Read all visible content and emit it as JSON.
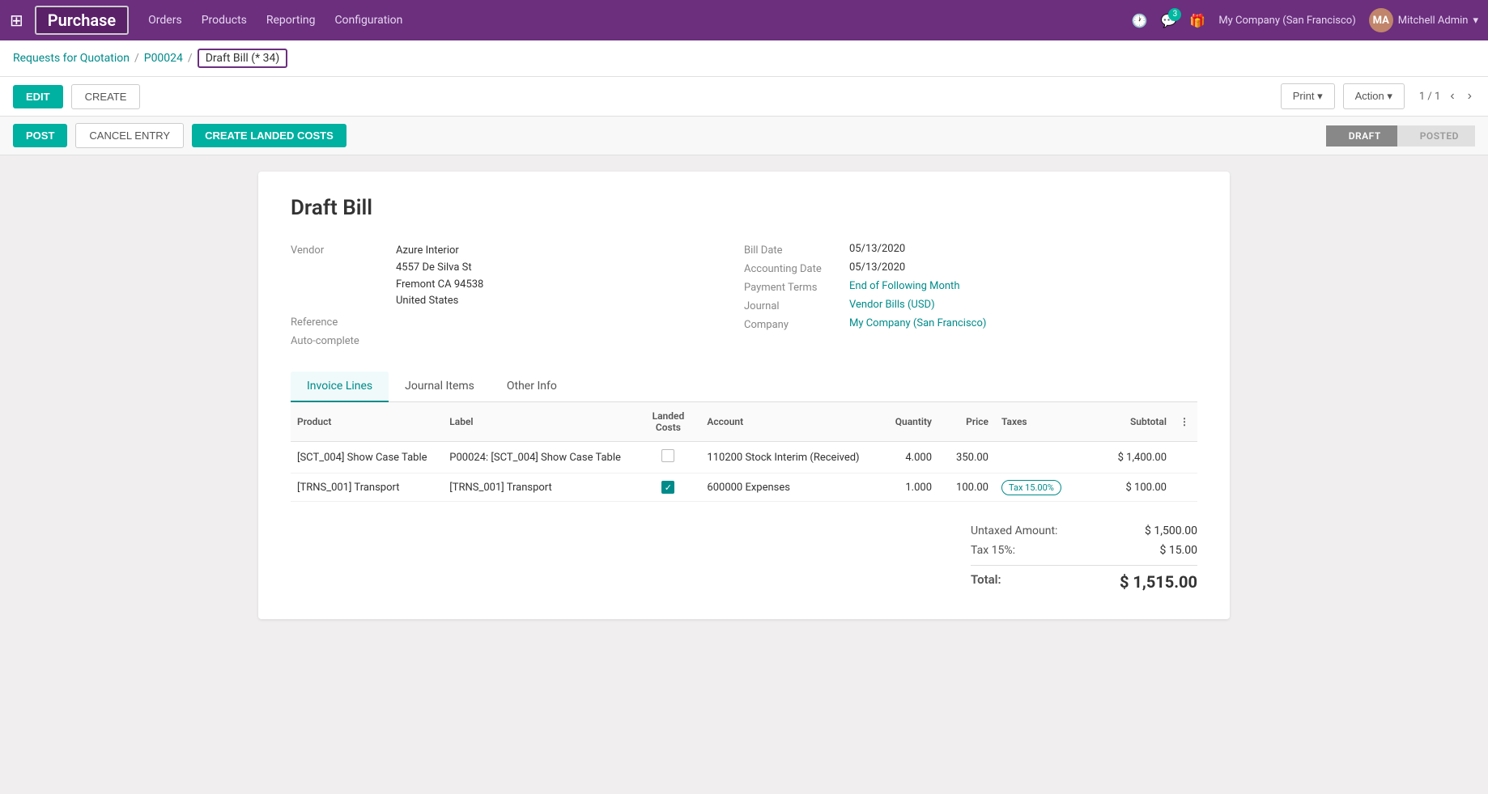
{
  "topnav": {
    "app_title": "Purchase",
    "menu_items": [
      "Orders",
      "Products",
      "Reporting",
      "Configuration"
    ],
    "badge_count": "3",
    "company": "My Company (San Francisco)",
    "user": "Mitchell Admin"
  },
  "breadcrumb": {
    "part1": "Requests for Quotation",
    "part2": "P00024",
    "part3": "Draft Bill (* 34)"
  },
  "toolbar": {
    "edit_label": "EDIT",
    "create_label": "CREATE",
    "print_label": "Print",
    "action_label": "Action",
    "pagination": "1 / 1"
  },
  "statusbar": {
    "post_label": "POST",
    "cancel_label": "CANCEL ENTRY",
    "landed_label": "CREATE LANDED COSTS",
    "steps": [
      {
        "label": "DRAFT",
        "active": true
      },
      {
        "label": "POSTED",
        "active": false
      }
    ]
  },
  "document": {
    "title": "Draft Bill",
    "vendor": {
      "label": "Vendor",
      "name": "Azure Interior",
      "address_line1": "4557 De Silva St",
      "address_line2": "Fremont CA 94538",
      "address_line3": "United States"
    },
    "reference": {
      "label": "Reference",
      "placeholder": ""
    },
    "auto_complete": {
      "label": "Auto-complete",
      "placeholder": ""
    },
    "bill_date": {
      "label": "Bill Date",
      "value": "05/13/2020"
    },
    "accounting_date": {
      "label": "Accounting Date",
      "value": "05/13/2020"
    },
    "payment_terms": {
      "label": "Payment Terms",
      "value": "End of Following Month"
    },
    "journal": {
      "label": "Journal",
      "value": "Vendor Bills (USD)"
    },
    "company": {
      "label": "Company",
      "value": "My Company (San Francisco)"
    }
  },
  "tabs": [
    {
      "label": "Invoice Lines",
      "active": true
    },
    {
      "label": "Journal Items",
      "active": false
    },
    {
      "label": "Other Info",
      "active": false
    }
  ],
  "table": {
    "headers": {
      "product": "Product",
      "label": "Label",
      "landed_costs": "Landed Costs",
      "account": "Account",
      "quantity": "Quantity",
      "price": "Price",
      "taxes": "Taxes",
      "subtotal": "Subtotal"
    },
    "rows": [
      {
        "product": "[SCT_004] Show Case Table",
        "label": "P00024: [SCT_004] Show Case Table",
        "landed_checked": false,
        "account": "110200 Stock Interim (Received)",
        "quantity": "4.000",
        "price": "350.00",
        "taxes": "",
        "subtotal": "$ 1,400.00"
      },
      {
        "product": "[TRNS_001] Transport",
        "label": "[TRNS_001] Transport",
        "landed_checked": true,
        "account": "600000 Expenses",
        "quantity": "1.000",
        "price": "100.00",
        "taxes": "Tax 15.00%",
        "subtotal": "$ 100.00"
      }
    ]
  },
  "totals": {
    "untaxed_label": "Untaxed Amount:",
    "untaxed_value": "$ 1,500.00",
    "tax_label": "Tax 15%:",
    "tax_value": "$ 15.00",
    "total_label": "Total:",
    "total_value": "$ 1,515.00"
  }
}
